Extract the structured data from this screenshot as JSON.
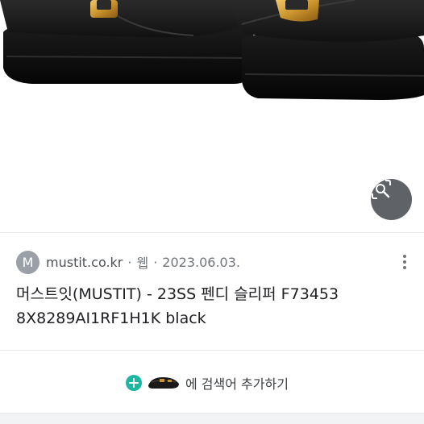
{
  "image": {
    "alt": "black slide sandal with gold buckle"
  },
  "lens": {
    "icon": "visual-search-icon"
  },
  "source": {
    "favicon_letter": "M",
    "site": "mustit.co.kr",
    "separator": "·",
    "type": "웹",
    "date": "2023.06.03.",
    "menu_icon": "more-vert-icon"
  },
  "result": {
    "title": "머스트잇(MUSTIT) - 23SS 펜디 슬리퍼 F73453 8X8289AI1RF1H1K black"
  },
  "add_search": {
    "icon": "plus-icon",
    "label": "에 검색어 추가하기"
  },
  "colors": {
    "accent": "#1fb5a3",
    "lens_button": "#5f6368",
    "favicon": "#9aa0a6",
    "title_text": "#202124"
  }
}
